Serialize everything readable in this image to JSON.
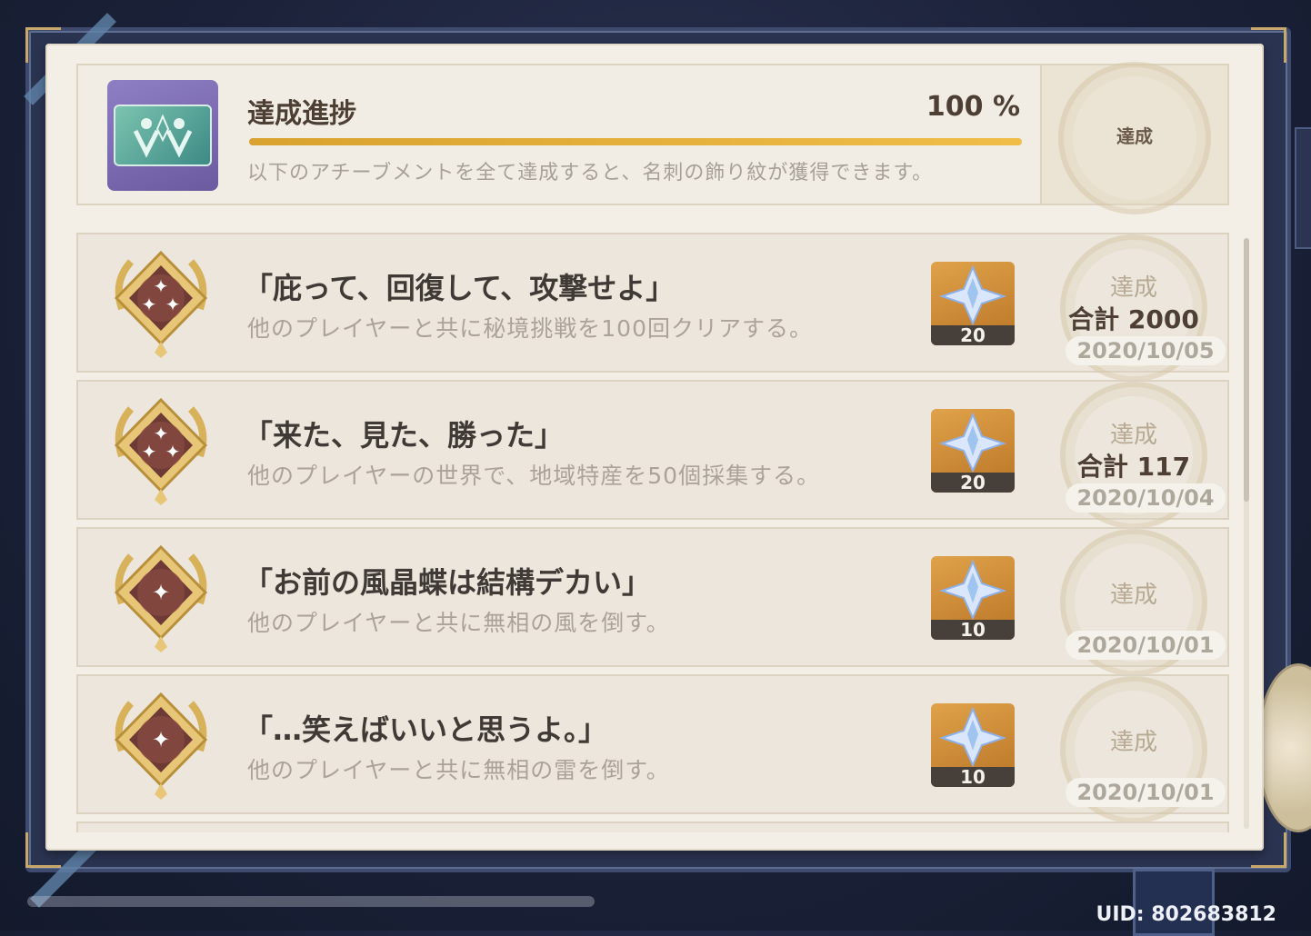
{
  "summary": {
    "title": "達成進捗",
    "percent": "100 %",
    "progress_fraction": 1.0,
    "description": "以下のアチーブメントを全て達成すると、名刺の飾り紋が獲得できます。",
    "stamp_label": "達成"
  },
  "achievements": [
    {
      "title": "「庇って、回復して、攻撃せよ」",
      "description": "他のプレイヤーと共に秘境挑戦を100回クリアする。",
      "reward_count": "20",
      "stamp_label": "達成",
      "total": "合計 2000",
      "date": "2020/10/05",
      "stars": 3
    },
    {
      "title": "「来た、見た、勝った」",
      "description": "他のプレイヤーの世界で、地域特産を50個採集する。",
      "reward_count": "20",
      "stamp_label": "達成",
      "total": "合計 117",
      "date": "2020/10/04",
      "stars": 3
    },
    {
      "title": "「お前の風晶蝶は結構デカい」",
      "description": "他のプレイヤーと共に無相の風を倒す。",
      "reward_count": "10",
      "stamp_label": "達成",
      "total": "",
      "date": "2020/10/01",
      "stars": 1
    },
    {
      "title": "「…笑えばいいと思うよ。」",
      "description": "他のプレイヤーと共に無相の雷を倒す。",
      "reward_count": "10",
      "stamp_label": "達成",
      "total": "",
      "date": "2020/10/01",
      "stars": 1
    }
  ],
  "footer": {
    "uid": "UID: 802683812"
  },
  "colors": {
    "accent_gold": "#e8b23c",
    "paper": "#f3efe7",
    "frame": "#2a3350"
  },
  "icons": {
    "summary_icon": "namecard-emblem-icon",
    "medal": "achievement-medal-icon",
    "reward": "primogem-icon"
  }
}
